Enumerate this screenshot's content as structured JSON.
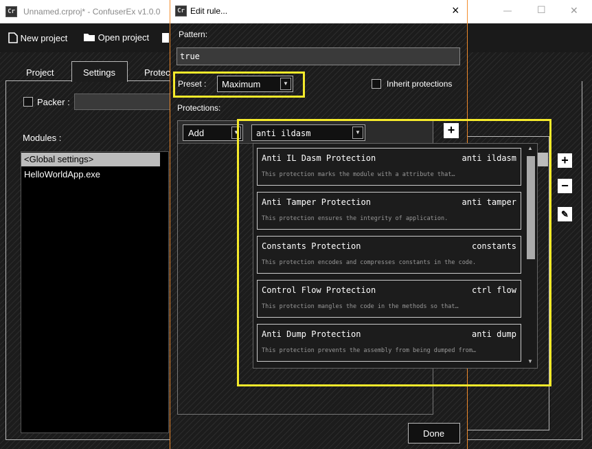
{
  "main_window": {
    "title": "Unnamed.crproj* - ConfuserEx v1.0.0",
    "toolbar": {
      "new_project": "New project",
      "open_project": "Open project"
    },
    "tabs": [
      "Project",
      "Settings",
      "Protec"
    ],
    "packer_label": "Packer :",
    "modules_label": "Modules :",
    "modules": [
      "<Global settings>",
      "HelloWorldApp.exe"
    ]
  },
  "dialog": {
    "title": "Edit rule...",
    "close_glyph": "×",
    "pattern_label": "Pattern:",
    "pattern_value": "true",
    "preset_label": "Preset :",
    "preset_value": "Maximum",
    "inherit_label": "Inherit protections",
    "protections_label": "Protections:",
    "action_value": "Add",
    "protection_value": "anti ildasm",
    "add_glyph": "+",
    "done_label": "Done",
    "options": [
      {
        "name": "Anti IL Dasm Protection",
        "id": "anti ildasm",
        "desc": "This protection marks the module with a attribute that…"
      },
      {
        "name": "Anti Tamper Protection",
        "id": "anti tamper",
        "desc": "This protection ensures the integrity of application."
      },
      {
        "name": "Constants Protection",
        "id": "constants",
        "desc": "This protection encodes and compresses constants in the code."
      },
      {
        "name": "Control Flow Protection",
        "id": "ctrl flow",
        "desc": "This protection mangles the code in the methods so that…"
      },
      {
        "name": "Anti Dump Protection",
        "id": "anti dump",
        "desc": "This protection prevents the assembly from being dumped from…"
      }
    ]
  },
  "side_buttons": {
    "add": "+",
    "remove": "−",
    "edit": "✎"
  },
  "window_controls": {
    "minimize": "—",
    "maximize": "☐",
    "close": "✕"
  },
  "colors": {
    "highlight": "#f5ea2b",
    "accent_border": "#f28b2b"
  }
}
